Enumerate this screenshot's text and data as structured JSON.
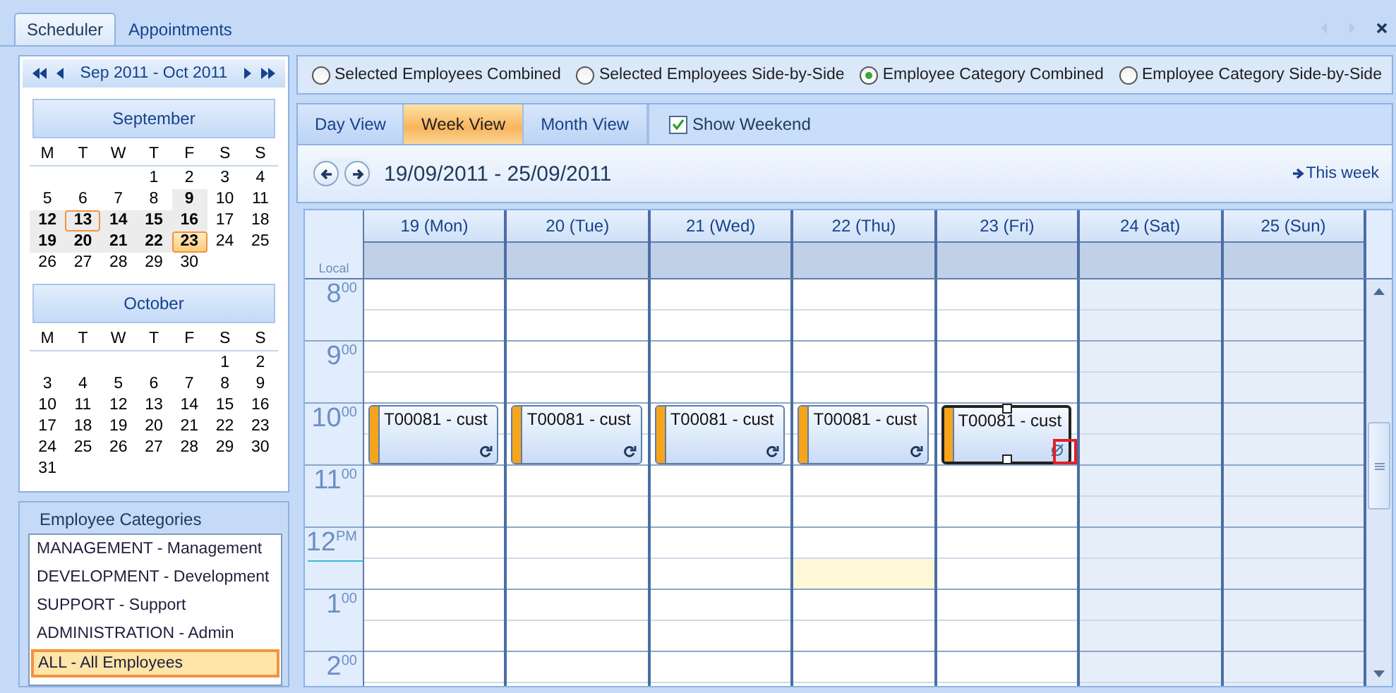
{
  "tabs": [
    {
      "label": "Scheduler",
      "selected": true
    },
    {
      "label": "Appointments",
      "selected": false
    }
  ],
  "date_navigator": {
    "title": "Sep 2011 - Oct 2011",
    "months": [
      {
        "name": "September",
        "weekdays": [
          "M",
          "T",
          "W",
          "T",
          "F",
          "S",
          "S"
        ],
        "weeks": [
          [
            {
              "d": "1",
              "bold": false,
              "shaded": false,
              "today": false,
              "selected": false
            },
            {
              "d": "2",
              "bold": false,
              "shaded": false,
              "today": false,
              "selected": false
            },
            {
              "d": "3",
              "bold": false,
              "shaded": false,
              "today": false,
              "selected": false
            },
            {
              "d": "4",
              "bold": false,
              "shaded": false,
              "today": false,
              "selected": false
            }
          ],
          [
            {
              "d": "5",
              "bold": false,
              "shaded": false,
              "today": false,
              "selected": false
            },
            {
              "d": "6",
              "bold": false,
              "shaded": false,
              "today": false,
              "selected": false
            },
            {
              "d": "7",
              "bold": false,
              "shaded": false,
              "today": false,
              "selected": false
            },
            {
              "d": "8",
              "bold": false,
              "shaded": false,
              "today": false,
              "selected": false
            },
            {
              "d": "9",
              "bold": true,
              "shaded": true,
              "today": false,
              "selected": false
            },
            {
              "d": "10",
              "bold": false,
              "shaded": false,
              "today": false,
              "selected": false
            },
            {
              "d": "11",
              "bold": false,
              "shaded": false,
              "today": false,
              "selected": false
            }
          ],
          [
            {
              "d": "12",
              "bold": true,
              "shaded": true,
              "today": false,
              "selected": false
            },
            {
              "d": "13",
              "bold": true,
              "shaded": true,
              "today": true,
              "selected": false
            },
            {
              "d": "14",
              "bold": true,
              "shaded": true,
              "today": false,
              "selected": false
            },
            {
              "d": "15",
              "bold": true,
              "shaded": true,
              "today": false,
              "selected": false
            },
            {
              "d": "16",
              "bold": true,
              "shaded": true,
              "today": false,
              "selected": false
            },
            {
              "d": "17",
              "bold": false,
              "shaded": false,
              "today": false,
              "selected": false
            },
            {
              "d": "18",
              "bold": false,
              "shaded": false,
              "today": false,
              "selected": false
            }
          ],
          [
            {
              "d": "19",
              "bold": true,
              "shaded": true,
              "today": false,
              "selected": false
            },
            {
              "d": "20",
              "bold": true,
              "shaded": true,
              "today": false,
              "selected": false
            },
            {
              "d": "21",
              "bold": true,
              "shaded": true,
              "today": false,
              "selected": false
            },
            {
              "d": "22",
              "bold": true,
              "shaded": true,
              "today": false,
              "selected": false
            },
            {
              "d": "23",
              "bold": true,
              "shaded": false,
              "today": false,
              "selected": true
            },
            {
              "d": "24",
              "bold": false,
              "shaded": false,
              "today": false,
              "selected": false
            },
            {
              "d": "25",
              "bold": false,
              "shaded": false,
              "today": false,
              "selected": false
            }
          ],
          [
            {
              "d": "26",
              "bold": false,
              "shaded": false,
              "today": false,
              "selected": false
            },
            {
              "d": "27",
              "bold": false,
              "shaded": false,
              "today": false,
              "selected": false
            },
            {
              "d": "28",
              "bold": false,
              "shaded": false,
              "today": false,
              "selected": false
            },
            {
              "d": "29",
              "bold": false,
              "shaded": false,
              "today": false,
              "selected": false
            },
            {
              "d": "30",
              "bold": false,
              "shaded": false,
              "today": false,
              "selected": false
            }
          ]
        ]
      },
      {
        "name": "October",
        "weekdays": [
          "M",
          "T",
          "W",
          "T",
          "F",
          "S",
          "S"
        ],
        "weeks": [
          [
            {
              "d": "1",
              "bold": false,
              "shaded": false,
              "today": false,
              "selected": false
            },
            {
              "d": "2",
              "bold": false,
              "shaded": false,
              "today": false,
              "selected": false
            }
          ],
          [
            {
              "d": "3",
              "bold": false,
              "shaded": false,
              "today": false,
              "selected": false
            },
            {
              "d": "4",
              "bold": false,
              "shaded": false,
              "today": false,
              "selected": false
            },
            {
              "d": "5",
              "bold": false,
              "shaded": false,
              "today": false,
              "selected": false
            },
            {
              "d": "6",
              "bold": false,
              "shaded": false,
              "today": false,
              "selected": false
            },
            {
              "d": "7",
              "bold": false,
              "shaded": false,
              "today": false,
              "selected": false
            },
            {
              "d": "8",
              "bold": false,
              "shaded": false,
              "today": false,
              "selected": false
            },
            {
              "d": "9",
              "bold": false,
              "shaded": false,
              "today": false,
              "selected": false
            }
          ],
          [
            {
              "d": "10",
              "bold": false,
              "shaded": false,
              "today": false,
              "selected": false
            },
            {
              "d": "11",
              "bold": false,
              "shaded": false,
              "today": false,
              "selected": false
            },
            {
              "d": "12",
              "bold": false,
              "shaded": false,
              "today": false,
              "selected": false
            },
            {
              "d": "13",
              "bold": false,
              "shaded": false,
              "today": false,
              "selected": false
            },
            {
              "d": "14",
              "bold": false,
              "shaded": false,
              "today": false,
              "selected": false
            },
            {
              "d": "15",
              "bold": false,
              "shaded": false,
              "today": false,
              "selected": false
            },
            {
              "d": "16",
              "bold": false,
              "shaded": false,
              "today": false,
              "selected": false
            }
          ],
          [
            {
              "d": "17",
              "bold": false,
              "shaded": false,
              "today": false,
              "selected": false
            },
            {
              "d": "18",
              "bold": false,
              "shaded": false,
              "today": false,
              "selected": false
            },
            {
              "d": "19",
              "bold": false,
              "shaded": false,
              "today": false,
              "selected": false
            },
            {
              "d": "20",
              "bold": false,
              "shaded": false,
              "today": false,
              "selected": false
            },
            {
              "d": "21",
              "bold": false,
              "shaded": false,
              "today": false,
              "selected": false
            },
            {
              "d": "22",
              "bold": false,
              "shaded": false,
              "today": false,
              "selected": false
            },
            {
              "d": "23",
              "bold": false,
              "shaded": false,
              "today": false,
              "selected": false
            }
          ],
          [
            {
              "d": "24",
              "bold": false,
              "shaded": false,
              "today": false,
              "selected": false
            },
            {
              "d": "25",
              "bold": false,
              "shaded": false,
              "today": false,
              "selected": false
            },
            {
              "d": "26",
              "bold": false,
              "shaded": false,
              "today": false,
              "selected": false
            },
            {
              "d": "27",
              "bold": false,
              "shaded": false,
              "today": false,
              "selected": false
            },
            {
              "d": "28",
              "bold": false,
              "shaded": false,
              "today": false,
              "selected": false
            },
            {
              "d": "29",
              "bold": false,
              "shaded": false,
              "today": false,
              "selected": false
            },
            {
              "d": "30",
              "bold": false,
              "shaded": false,
              "today": false,
              "selected": false
            }
          ],
          [
            {
              "d": "31",
              "bold": false,
              "shaded": false,
              "today": false,
              "selected": false
            }
          ]
        ]
      }
    ]
  },
  "employee_categories": {
    "title": "Employee Categories",
    "items": [
      {
        "label": "MANAGEMENT - Management",
        "selected": false
      },
      {
        "label": "DEVELOPMENT - Development",
        "selected": false
      },
      {
        "label": "SUPPORT - Support",
        "selected": false
      },
      {
        "label": "ADMINISTRATION - Admin",
        "selected": false
      },
      {
        "label": "ALL - All Employees",
        "selected": true
      }
    ]
  },
  "modes": [
    {
      "label": "Selected Employees Combined",
      "selected": false
    },
    {
      "label": "Selected Employees Side-by-Side",
      "selected": false
    },
    {
      "label": "Employee Category Combined",
      "selected": true
    },
    {
      "label": "Employee Category Side-by-Side",
      "selected": false
    }
  ],
  "views": [
    {
      "label": "Day View",
      "selected": false
    },
    {
      "label": "Week View",
      "selected": true
    },
    {
      "label": "Month View",
      "selected": false
    }
  ],
  "show_weekend": {
    "label": "Show Weekend",
    "checked": true
  },
  "range": {
    "title": "19/09/2011 - 25/09/2011",
    "this_week": "This week"
  },
  "grid": {
    "timezone": "Local",
    "days": [
      {
        "label": "19 (Mon)",
        "weekend": false
      },
      {
        "label": "20 (Tue)",
        "weekend": false
      },
      {
        "label": "21 (Wed)",
        "weekend": false
      },
      {
        "label": "22 (Thu)",
        "weekend": false
      },
      {
        "label": "23 (Fri)",
        "weekend": false
      },
      {
        "label": "24 (Sat)",
        "weekend": true
      },
      {
        "label": "25 (Sun)",
        "weekend": true
      }
    ],
    "hours": [
      {
        "label": "8$^{00}$",
        "now_line": false,
        "cells": [
          {
            "lower_selected": false
          },
          {
            "lower_selected": false
          },
          {
            "lower_selected": false
          },
          {
            "lower_selected": false
          },
          {
            "lower_selected": false
          },
          {
            "lower_selected": false
          },
          {
            "lower_selected": false
          }
        ]
      },
      {
        "label": "9$^{00}$",
        "now_line": false,
        "cells": [
          {
            "lower_selected": false
          },
          {
            "lower_selected": false
          },
          {
            "lower_selected": false
          },
          {
            "lower_selected": false
          },
          {
            "lower_selected": false
          },
          {
            "lower_selected": false
          },
          {
            "lower_selected": false
          }
        ]
      },
      {
        "label": "10$^{00}$",
        "now_line": false,
        "cells": [
          {
            "lower_selected": false,
            "appointment": {
              "text": "T00081 - cust",
              "selected": false,
              "kind": "recurring",
              "flagged": false
            }
          },
          {
            "lower_selected": false,
            "appointment": {
              "text": "T00081 - cust",
              "selected": false,
              "kind": "recurring",
              "flagged": false
            }
          },
          {
            "lower_selected": false,
            "appointment": {
              "text": "T00081 - cust",
              "selected": false,
              "kind": "recurring",
              "flagged": false
            }
          },
          {
            "lower_selected": false,
            "appointment": {
              "text": "T00081 - cust",
              "selected": false,
              "kind": "recurring",
              "flagged": false
            }
          },
          {
            "lower_selected": false,
            "appointment": {
              "text": "T00081 - cust",
              "selected": true,
              "kind": "exception",
              "flagged": true
            }
          },
          {
            "lower_selected": false
          },
          {
            "lower_selected": false
          }
        ]
      },
      {
        "label": "11$^{00}$",
        "now_line": false,
        "cells": [
          {
            "lower_selected": false
          },
          {
            "lower_selected": false
          },
          {
            "lower_selected": false
          },
          {
            "lower_selected": false
          },
          {
            "lower_selected": false
          },
          {
            "lower_selected": false
          },
          {
            "lower_selected": false
          }
        ]
      },
      {
        "label": "12$^{PM}$",
        "now_line": true,
        "cells": [
          {
            "lower_selected": false
          },
          {
            "lower_selected": false
          },
          {
            "lower_selected": false
          },
          {
            "lower_selected": true
          },
          {
            "lower_selected": false
          },
          {
            "lower_selected": false
          },
          {
            "lower_selected": false
          }
        ]
      },
      {
        "label": "1$^{00}$",
        "now_line": false,
        "cells": [
          {
            "lower_selected": false
          },
          {
            "lower_selected": false
          },
          {
            "lower_selected": false
          },
          {
            "lower_selected": false
          },
          {
            "lower_selected": false
          },
          {
            "lower_selected": false
          },
          {
            "lower_selected": false
          }
        ]
      },
      {
        "label": "2$^{00}$",
        "now_line": false,
        "cells": [
          {
            "lower_selected": false
          },
          {
            "lower_selected": false
          },
          {
            "lower_selected": false
          },
          {
            "lower_selected": false
          },
          {
            "lower_selected": false
          },
          {
            "lower_selected": false
          },
          {
            "lower_selected": false
          }
        ]
      }
    ]
  }
}
